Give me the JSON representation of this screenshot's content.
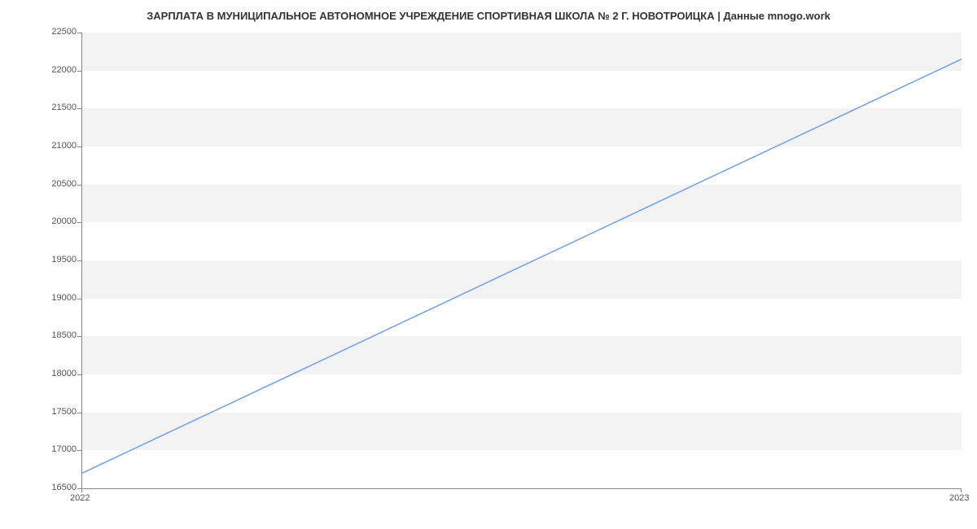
{
  "chart_data": {
    "type": "line",
    "title": "ЗАРПЛАТА В МУНИЦИПАЛЬНОЕ АВТОНОМНОЕ УЧРЕЖДЕНИЕ СПОРТИВНАЯ ШКОЛА № 2 Г. НОВОТРОИЦКА | Данные mnogo.work",
    "x": [
      "2022",
      "2023"
    ],
    "values": [
      16700,
      22150
    ],
    "y_ticks": [
      16500,
      17000,
      17500,
      18000,
      18500,
      19000,
      19500,
      20000,
      20500,
      21000,
      21500,
      22000,
      22500
    ],
    "x_ticks": [
      "2022",
      "2023"
    ],
    "ylim": [
      16500,
      22500
    ],
    "xlabel": "",
    "ylabel": ""
  }
}
